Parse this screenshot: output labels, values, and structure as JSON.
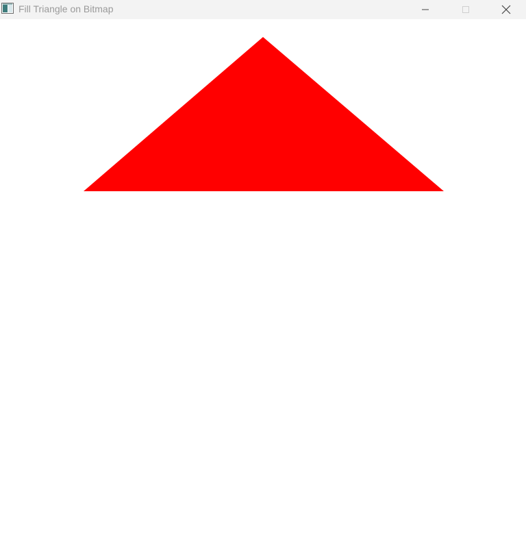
{
  "window": {
    "title": "Fill Triangle on Bitmap"
  },
  "titlebar_icons": {
    "app": "window-app-icon",
    "minimize": "minimize-icon",
    "maximize": "maximize-icon",
    "close": "close-icon"
  },
  "colors": {
    "triangle_fill": "#ff0000",
    "background": "#ffffff",
    "titlebar_background": "#f3f3f3",
    "title_text": "#9a9a9a",
    "caption_glyph": "#444444",
    "caption_glyph_disabled": "#cfcfcf"
  }
}
